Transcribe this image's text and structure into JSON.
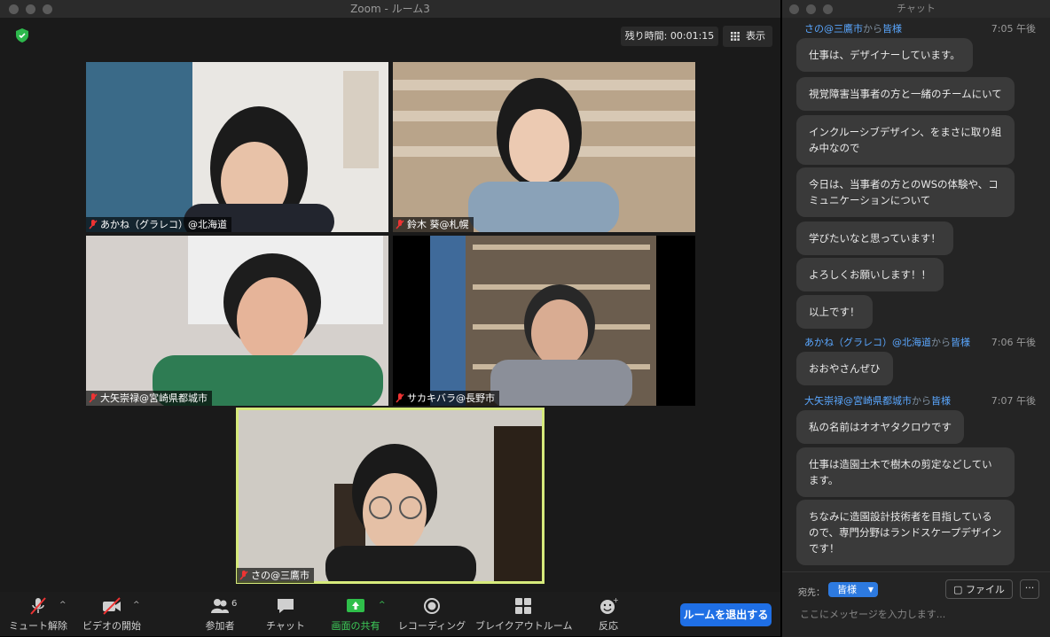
{
  "window": {
    "title": "Zoom - ルーム3"
  },
  "meeting": {
    "timer": "残り時間: 00:01:15",
    "view_label": "表示",
    "participants": [
      {
        "name": "あかね（グラレコ）@北海道",
        "bg": "#3a6a88"
      },
      {
        "name": "鈴木 葵@札幌",
        "bg": "#a08a70"
      },
      {
        "name": "大矢崇禄@宮崎県都城市",
        "bg": "#d8d3cf"
      },
      {
        "name": "サカキバラ@長野市",
        "bg": "#6b5d4e"
      },
      {
        "name": "さの@三鷹市",
        "bg": "#cfcbc4"
      }
    ]
  },
  "toolbar": {
    "mute": "ミュート解除",
    "video": "ビデオの開始",
    "participants": "参加者",
    "participant_count": "6",
    "chat": "チャット",
    "share": "画面の共有",
    "record": "レコーディング",
    "breakout": "ブレイクアウトルーム",
    "reactions": "反応",
    "leave": "ルームを退出する"
  },
  "chat": {
    "title": "チャット",
    "groups": [
      {
        "sender": "さの@三鷹市",
        "from": "から",
        "to": "皆様",
        "time": "7:05 午後",
        "messages": [
          "仕事は、デザイナーしています。",
          "視覚障害当事者の方と一緒のチームにいて",
          "インクルーシブデザイン、をまさに取り組み中なので",
          "今日は、当事者の方とのWSの体験や、コミュニケーションについて",
          "学びたいなと思っています！",
          "よろしくお願いします！！",
          "以上です！"
        ]
      },
      {
        "sender": "あかね（グラレコ）@北海道",
        "from": "から",
        "to": "皆様",
        "time": "7:06 午後",
        "messages": [
          "おおやさんぜひ"
        ]
      },
      {
        "sender": "大矢崇禄@宮崎県都城市",
        "from": "から",
        "to": "皆様",
        "time": "7:07 午後",
        "messages": [
          "私の名前はオオヤタクロウです",
          "仕事は造園土木で樹木の剪定などしています。",
          "ちなみに造園設計技術者を目指しているので、専門分野はランドスケープデザインです！"
        ]
      }
    ],
    "to_label": "宛先：",
    "to_value": "皆様",
    "file_button": "ファイル",
    "more_button": "···",
    "placeholder": "ここにメッセージを入力します..."
  }
}
